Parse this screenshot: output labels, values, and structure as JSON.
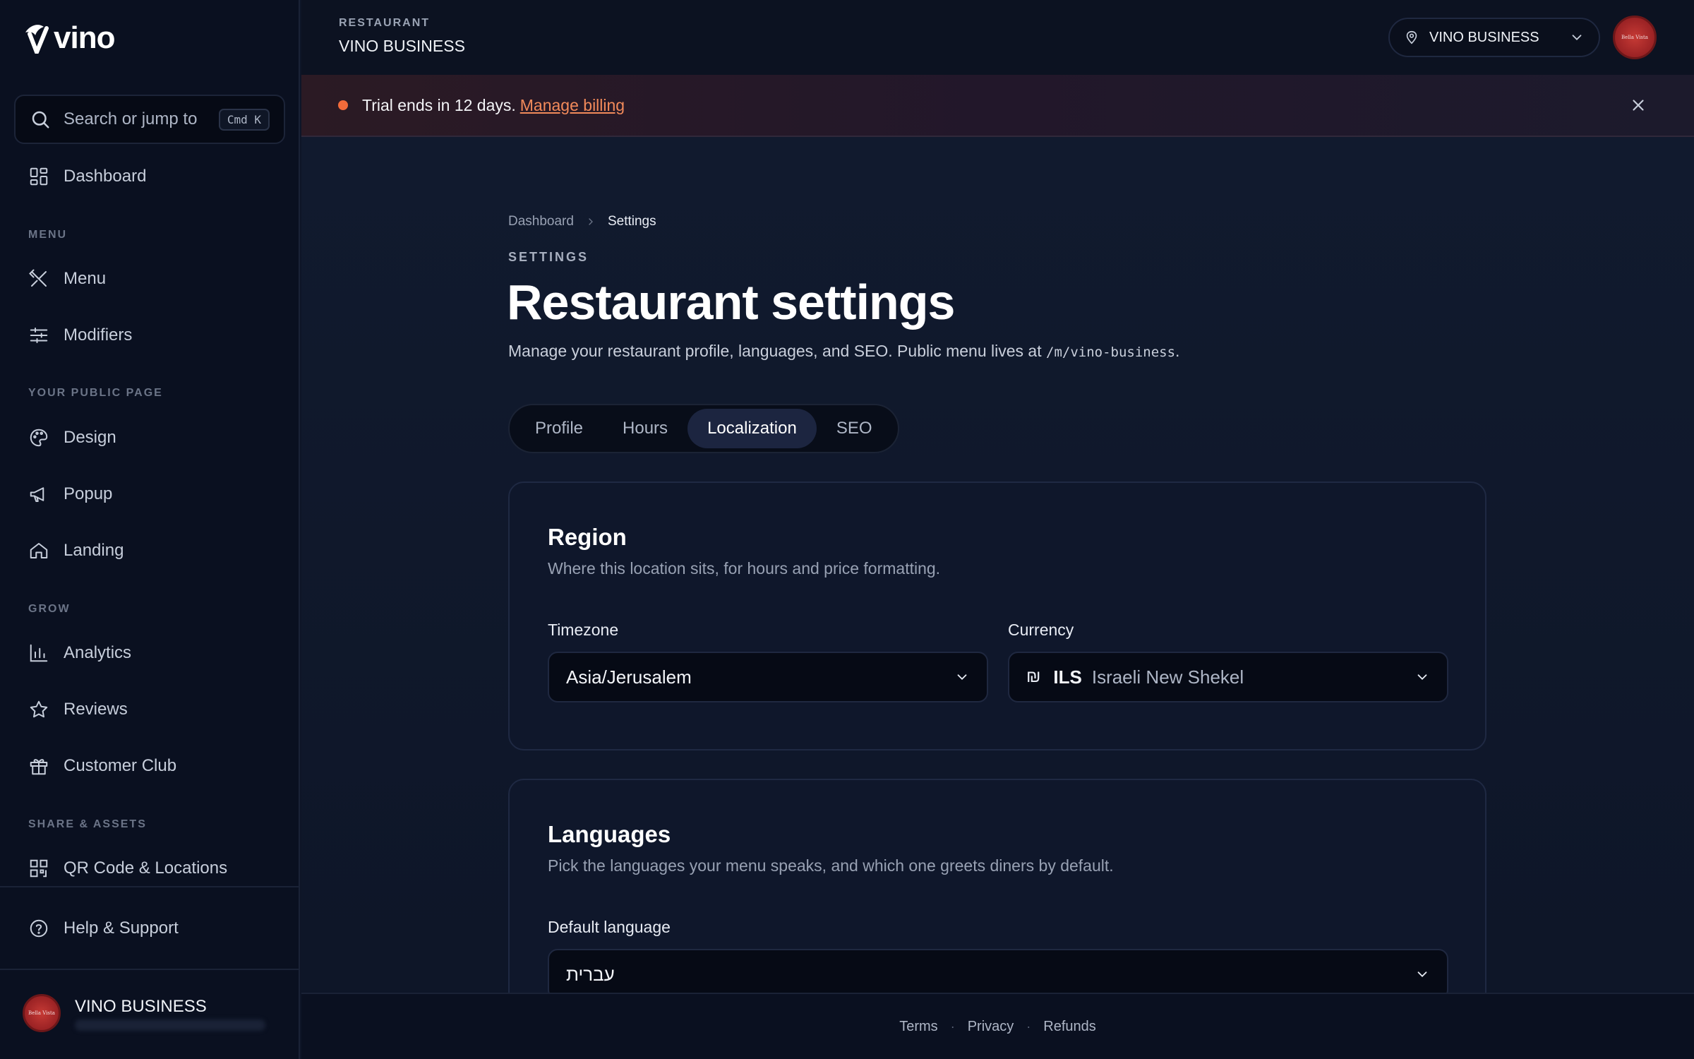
{
  "app": {
    "logo_text": "vino"
  },
  "sidebar": {
    "search": {
      "label": "Search or jump to",
      "shortcut": "Cmd K"
    },
    "dashboard": "Dashboard",
    "sections": {
      "menu": "MENU",
      "public_page": "YOUR PUBLIC PAGE",
      "grow": "GROW",
      "share": "SHARE & ASSETS"
    },
    "items": {
      "menu": "Menu",
      "modifiers": "Modifiers",
      "design": "Design",
      "popup": "Popup",
      "landing": "Landing",
      "analytics": "Analytics",
      "reviews": "Reviews",
      "customer_club": "Customer Club",
      "qr_code": "QR Code & Locations",
      "help": "Help & Support"
    },
    "profile": {
      "name": "VINO BUSINESS",
      "avatar_text": "Bella Vista"
    }
  },
  "header": {
    "restaurant_label": "RESTAURANT",
    "restaurant_name": "VINO BUSINESS",
    "location_selector": "VINO BUSINESS",
    "avatar_text": "Bella Vista"
  },
  "banner": {
    "text": "Trial ends in 12 days.",
    "link": "Manage billing",
    "dot_color": "#f26b3a"
  },
  "breadcrumb": {
    "root": "Dashboard",
    "current": "Settings"
  },
  "page": {
    "eyebrow": "SETTINGS",
    "title": "Restaurant settings",
    "description": "Manage your restaurant profile, languages, and SEO. Public menu lives at",
    "path": "/m/vino-business",
    "description_end": "."
  },
  "tabs": [
    {
      "label": "Profile",
      "active": false
    },
    {
      "label": "Hours",
      "active": false
    },
    {
      "label": "Localization",
      "active": true
    },
    {
      "label": "SEO",
      "active": false
    }
  ],
  "region": {
    "title": "Region",
    "subtitle": "Where this location sits, for hours and price formatting.",
    "timezone": {
      "label": "Timezone",
      "value": "Asia/Jerusalem"
    },
    "currency": {
      "label": "Currency",
      "symbol": "₪",
      "code": "ILS",
      "name": "Israeli New Shekel"
    }
  },
  "languages": {
    "title": "Languages",
    "subtitle": "Pick the languages your menu speaks, and which one greets diners by default.",
    "default_language": {
      "label": "Default language",
      "value": "עברית"
    }
  },
  "footer": {
    "terms": "Terms",
    "privacy": "Privacy",
    "refunds": "Refunds",
    "separator": "·"
  }
}
